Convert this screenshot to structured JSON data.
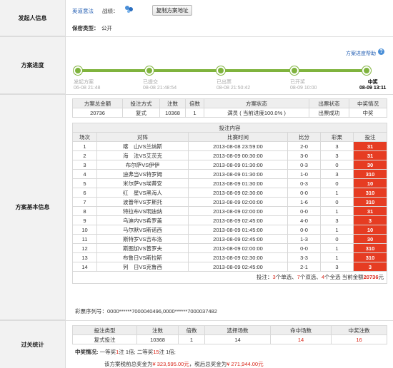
{
  "initiator": {
    "section_label": "发起人信息",
    "username": "英道意法",
    "record_label": "战绩：",
    "copy_button": "复制方案地址",
    "privacy_label": "保密类型：",
    "privacy_value": "公开"
  },
  "progress": {
    "section_label": "方案进度",
    "help_link": "方案进度帮助",
    "steps": [
      {
        "name": "发起方案",
        "time": "06-08 21:48"
      },
      {
        "name": "已提交",
        "time": "08-08 21:48:54"
      },
      {
        "name": "已出票",
        "time": "08-08 21:50:42"
      },
      {
        "name": "已开奖",
        "time": "08-09 10:00"
      },
      {
        "name": "中奖",
        "time": "08-09 13:11"
      }
    ]
  },
  "basic": {
    "section_label": "方案基本信息",
    "summary_headers": [
      "方案总金额",
      "投注方式",
      "注数",
      "倍数",
      "方案状态",
      "出票状态",
      "中奖情况"
    ],
    "summary_values": [
      "20736",
      "复式",
      "10368",
      "1",
      "满员 ( 当前进度100.0% )",
      "出票成功",
      "中奖"
    ],
    "bet_title": "投注内容",
    "bet_headers": [
      "场次",
      "对阵",
      "比赛时间",
      "比分",
      "彩果",
      "投注"
    ],
    "rows": [
      [
        "1",
        "喀　山VS兰纳斯",
        "2013-08-08 23:59:00",
        "2-0",
        "3",
        "31"
      ],
      [
        "2",
        "海　法VS艾茨克",
        "2013-08-09 00:30:00",
        "3-0",
        "3",
        "31"
      ],
      [
        "3",
        "布尔萨VS伊伊",
        "2013-08-09 01:30:00",
        "0-3",
        "0",
        "30"
      ],
      [
        "4",
        "迪弗当VS特罗姆",
        "2013-08-09 01:30:00",
        "1-0",
        "3",
        "310"
      ],
      [
        "5",
        "米尔萨VS埃蒂安",
        "2013-08-09 01:30:00",
        "0-3",
        "0",
        "10"
      ],
      [
        "6",
        "红　星VS黑海人",
        "2013-08-09 02:30:00",
        "0-0",
        "1",
        "310"
      ],
      [
        "7",
        "波普年VS罗斯托",
        "2013-08-09 02:00:00",
        "1-6",
        "0",
        "310"
      ],
      [
        "8",
        "特拉布VS明迪纳",
        "2013-08-09 02:00:00",
        "0-0",
        "1",
        "31"
      ],
      [
        "9",
        "乌迪内VS希罗盖",
        "2013-08-09 02:45:00",
        "4-0",
        "3",
        "3"
      ],
      [
        "10",
        "马尔默VS斯诺西",
        "2013-08-09 01:45:00",
        "0-0",
        "1",
        "10"
      ],
      [
        "11",
        "斯特罗VS吉布洛",
        "2013-08-09 02:45:00",
        "1-3",
        "0",
        "30"
      ],
      [
        "12",
        "斯图加VS普罗夫",
        "2013-08-09 02:00:00",
        "0-0",
        "1",
        "310"
      ],
      [
        "13",
        "布鲁日VS斯拉斯",
        "2013-08-09 02:30:00",
        "3-3",
        "1",
        "310"
      ],
      [
        "14",
        "列　日VS克鲁西",
        "2013-08-09 02:45:00",
        "2-1",
        "3",
        "3"
      ]
    ],
    "footer": {
      "prefix": "投注：",
      "single_count": "3",
      "single_label": "个单选、",
      "double_count": "7",
      "double_label": "个双选、",
      "full_count": "4",
      "full_label": "个全选 当前金额",
      "amount": "20736",
      "unit": "元"
    },
    "serial_label": "彩票序列号：",
    "serial_value": "0000******7000040496,0000******7000037482"
  },
  "settlement": {
    "section_label": "过关统计",
    "headers": [
      "投注类型",
      "注数",
      "倍数",
      "选择场数",
      "命中场数",
      "中奖注数"
    ],
    "values": [
      "复式投注",
      "10368",
      "1",
      "14",
      "14",
      "16"
    ],
    "win_label": "中奖情况:",
    "win_p1": "一等奖",
    "win_first_count": "1",
    "win_p2": "注 1倍; 二等奖",
    "win_second_count": "15",
    "win_p3": "注 1倍;",
    "prize_p1": "该方案税前总奖金为",
    "prize_before_tax": "¥ 323,595.00元",
    "prize_p2": "，税后总奖金为",
    "prize_after_tax": "¥ 271,944.00元"
  },
  "colors": {
    "accent_green": "#7fb33d",
    "bet_red": "#e63c22",
    "text_red": "#d9281c",
    "link_blue": "#2a63b5"
  }
}
